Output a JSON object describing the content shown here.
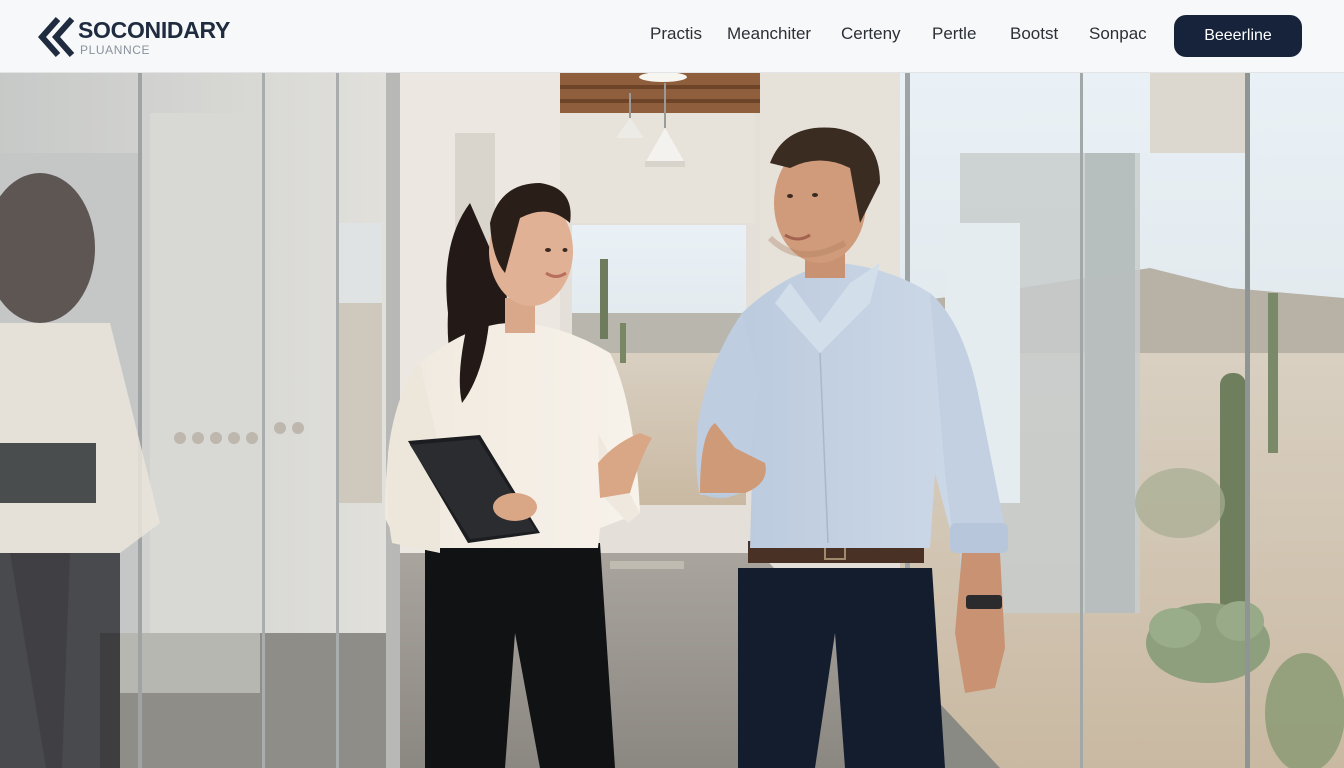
{
  "header": {
    "logo": {
      "title": "SOCONIDARY",
      "subtitle": "PLUANNCE",
      "icon": "double-chevron-left-icon"
    },
    "nav": [
      "Practis",
      "Meanchiter",
      "Certeny",
      "Pertle",
      "Bootst",
      "Sonpac"
    ],
    "cta_label": "Beeerline"
  },
  "hero": {
    "image": "two-professionals-walking-glass-corridor-desert-view"
  },
  "colors": {
    "header_bg": "#f7f8f9",
    "brand_navy": "#17233a",
    "logo_text": "#1f2b3f"
  }
}
